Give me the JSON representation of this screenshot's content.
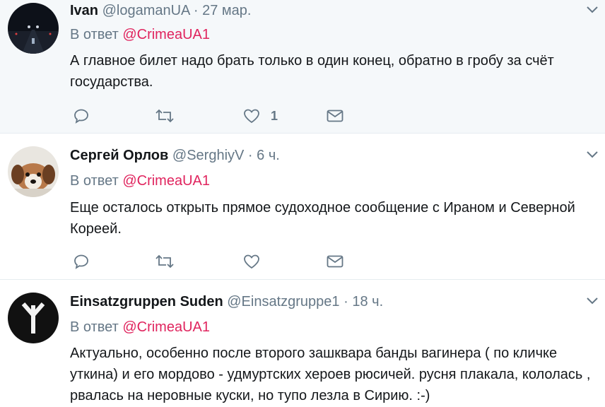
{
  "tweets": [
    {
      "name": "Ivan",
      "handle": "@logamanUA",
      "separator": "·",
      "time": "27 мар.",
      "reply_prefix": "В ответ",
      "reply_mention": "@CrimeaUA1",
      "text": "А главное билет надо брать только в один конец, обратно в гробу за счёт государства.",
      "like_count": "1",
      "avatar": "road-night-avatar"
    },
    {
      "name": "Сергей Орлов",
      "handle": "@SerghiyV",
      "separator": "·",
      "time": "6 ч.",
      "reply_prefix": "В ответ",
      "reply_mention": "@CrimeaUA1",
      "text": "Еще осталось открыть прямое судоходное сообщение с Ираном и Северной Кореей.",
      "like_count": "",
      "avatar": "puppy-avatar"
    },
    {
      "name": "Einsatzgruppen Suden",
      "handle": "@Einsatzgruppe1",
      "separator": "·",
      "time": "18 ч.",
      "reply_prefix": "В ответ",
      "reply_mention": "@CrimeaUA1",
      "text": "Актуально, особенно после второго зашквара банды вагинера ( по кличке уткина) и его мордово - удмуртских хероев рюсичей. русня плакала, кололась , рвалась на неровные куски, но тупо лезла в Сирию. :-)",
      "like_count": "",
      "avatar": "rune-avatar"
    }
  ],
  "icons": [
    "reply-icon",
    "retweet-icon",
    "like-icon",
    "message-icon",
    "chevron-down-icon"
  ],
  "colors": {
    "name": "#14171a",
    "meta": "#657786",
    "mention": "#e0245e",
    "highlight_bg": "#f5f8fa",
    "divider": "#e6ecf0"
  }
}
